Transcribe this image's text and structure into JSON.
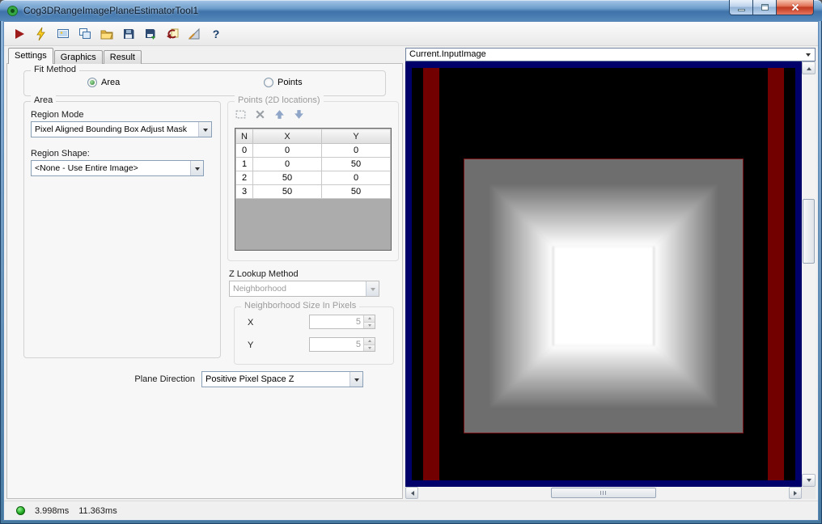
{
  "window": {
    "title": "Cog3DRangeImagePlaneEstimatorTool1"
  },
  "toolbar": {
    "icons": [
      "run-icon",
      "electric-icon",
      "image-window-icon",
      "new-window-icon",
      "open-icon",
      "save-icon",
      "save-image-icon",
      "reset-icon",
      "measure-icon",
      "help-icon"
    ],
    "help_glyph": "?"
  },
  "tabs": [
    {
      "label": "Settings",
      "active": true
    },
    {
      "label": "Graphics",
      "active": false
    },
    {
      "label": "Result",
      "active": false
    }
  ],
  "fit_method": {
    "group_label": "Fit Method",
    "options": [
      {
        "label": "Area",
        "selected": true
      },
      {
        "label": "Points",
        "selected": false
      }
    ]
  },
  "area_group": {
    "group_label": "Area",
    "region_mode_label": "Region Mode",
    "region_mode_value": "Pixel Aligned Bounding Box Adjust Mask",
    "region_shape_label": "Region Shape:",
    "region_shape_value": "<None - Use Entire Image>"
  },
  "points_group": {
    "group_label": "Points (2D locations)",
    "grid": {
      "headers": [
        "N",
        "X",
        "Y"
      ],
      "rows": [
        [
          "0",
          "0",
          "0"
        ],
        [
          "1",
          "0",
          "50"
        ],
        [
          "2",
          "50",
          "0"
        ],
        [
          "3",
          "50",
          "50"
        ]
      ]
    },
    "z_lookup_label": "Z Lookup Method",
    "z_lookup_value": "Neighborhood",
    "neighborhood_group_label": "Neighborhood Size In Pixels",
    "x_label": "X",
    "x_value": "5",
    "y_label": "Y",
    "y_value": "5"
  },
  "plane_direction": {
    "label": "Plane Direction",
    "value": "Positive Pixel Space Z"
  },
  "image_panel": {
    "source_selector": "Current.InputImage"
  },
  "statusbar": {
    "time_1": "3.998ms",
    "time_2": "11.363ms"
  },
  "colors": {
    "titlebar_top": "#a6c7e7",
    "titlebar_bottom": "#3f72a9",
    "image_frame": "#00006b",
    "image_stripe": "#730000",
    "range_gray": "#6e6e6e",
    "range_plateau": "#ffffff",
    "status_led": "#21a821"
  }
}
